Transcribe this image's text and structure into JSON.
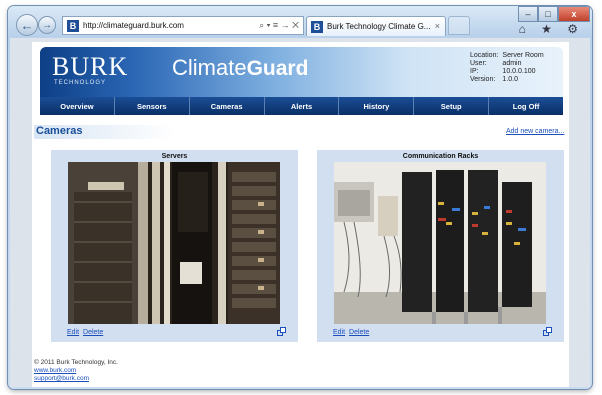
{
  "browser": {
    "back_icon": "back-arrow-icon",
    "forward_icon": "forward-arrow-icon",
    "address_url": "http://climateguard.burk.com",
    "address_tools": "⌕ ▾ ≡ → ✕",
    "tab_title": "Burk Technology Climate G...",
    "tab_close": "×",
    "window_controls": {
      "minimize": "–",
      "maximize": "□",
      "close": "x"
    },
    "toolbar_icons": "⌂ ★ ⚙"
  },
  "header": {
    "logo_main": "BURK",
    "logo_sub": "TECHNOLOGY",
    "product_pre": "Climate",
    "product_post": "Guard",
    "info": {
      "location_label": "Location:",
      "location_value": "Server Room",
      "user_label": "User:",
      "user_value": "admin",
      "ip_label": "IP:",
      "ip_value": "10.0.0.100",
      "version_label": "Version:",
      "version_value": "1.0.0"
    }
  },
  "menu": {
    "overview": "Overview",
    "sensors": "Sensors",
    "cameras": "Cameras",
    "alerts": "Alerts",
    "history": "History",
    "setup": "Setup",
    "logoff": "Log Off"
  },
  "main": {
    "title": "Cameras",
    "add_link": "Add new camera...",
    "cameras": [
      {
        "name": "Servers",
        "edit": "Edit",
        "delete": "Delete"
      },
      {
        "name": "Communication Racks",
        "edit": "Edit",
        "delete": "Delete"
      }
    ]
  },
  "footer": {
    "copyright": "© 2011 Burk Technology, Inc.",
    "website": "www.burk.com",
    "email": "support@burk.com"
  },
  "colors": {
    "brand_blue": "#1a4f99",
    "menu_bg": "#0a2f66",
    "link": "#1a4fbd"
  }
}
